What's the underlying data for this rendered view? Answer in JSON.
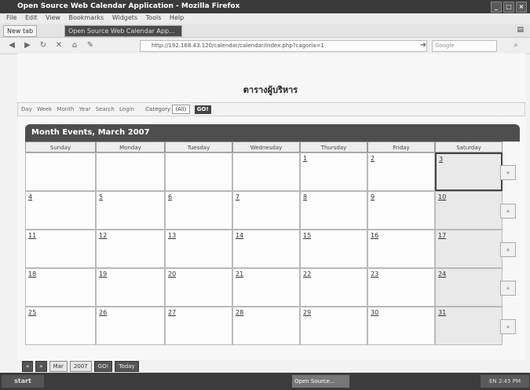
{
  "window": {
    "title": "Open Source Web Calendar Application - Mozilla Firefox",
    "buttons": [
      "_",
      "□",
      "×"
    ]
  },
  "menu": [
    "File",
    "Edit",
    "View",
    "Bookmarks",
    "Widgets",
    "Tools",
    "Help"
  ],
  "tabs": {
    "new_tab": "New tab",
    "active": "Open Source Web Calendar App..."
  },
  "nav": {
    "url": "http://192.168.43.120/calendar/calendar/index.php?cagoria=1",
    "search_placeholder": "Google"
  },
  "page": {
    "heading": "ตารางผู้บริหาร",
    "toolbar": {
      "views": [
        "Day",
        "Week",
        "Month",
        "Year",
        "Search",
        "Login"
      ],
      "category_label": "Category",
      "category_value": "(All)",
      "go": "GO!"
    },
    "calendar": {
      "header": "Month Events, March 2007",
      "days": [
        "Sunday",
        "Monday",
        "Tuesday",
        "Wednesday",
        "Thursday",
        "Friday",
        "Saturday"
      ],
      "weeks": [
        [
          "",
          "",
          "",
          "",
          "1",
          "2",
          "3"
        ],
        [
          "4",
          "5",
          "6",
          "7",
          "8",
          "9",
          "10"
        ],
        [
          "11",
          "12",
          "13",
          "14",
          "15",
          "16",
          "17"
        ],
        [
          "18",
          "19",
          "20",
          "21",
          "22",
          "23",
          "24"
        ],
        [
          "25",
          "26",
          "27",
          "28",
          "29",
          "30",
          "31"
        ]
      ],
      "today": "3",
      "week_arrow": "»"
    },
    "bottom_nav": {
      "prev": "«",
      "next": "»",
      "month": "Mar",
      "year": "2007",
      "go": "GO!",
      "today": "Today"
    }
  },
  "statusbar": {
    "start": "start",
    "task": "Open Source...",
    "tray": "EN 2:45 PM"
  }
}
